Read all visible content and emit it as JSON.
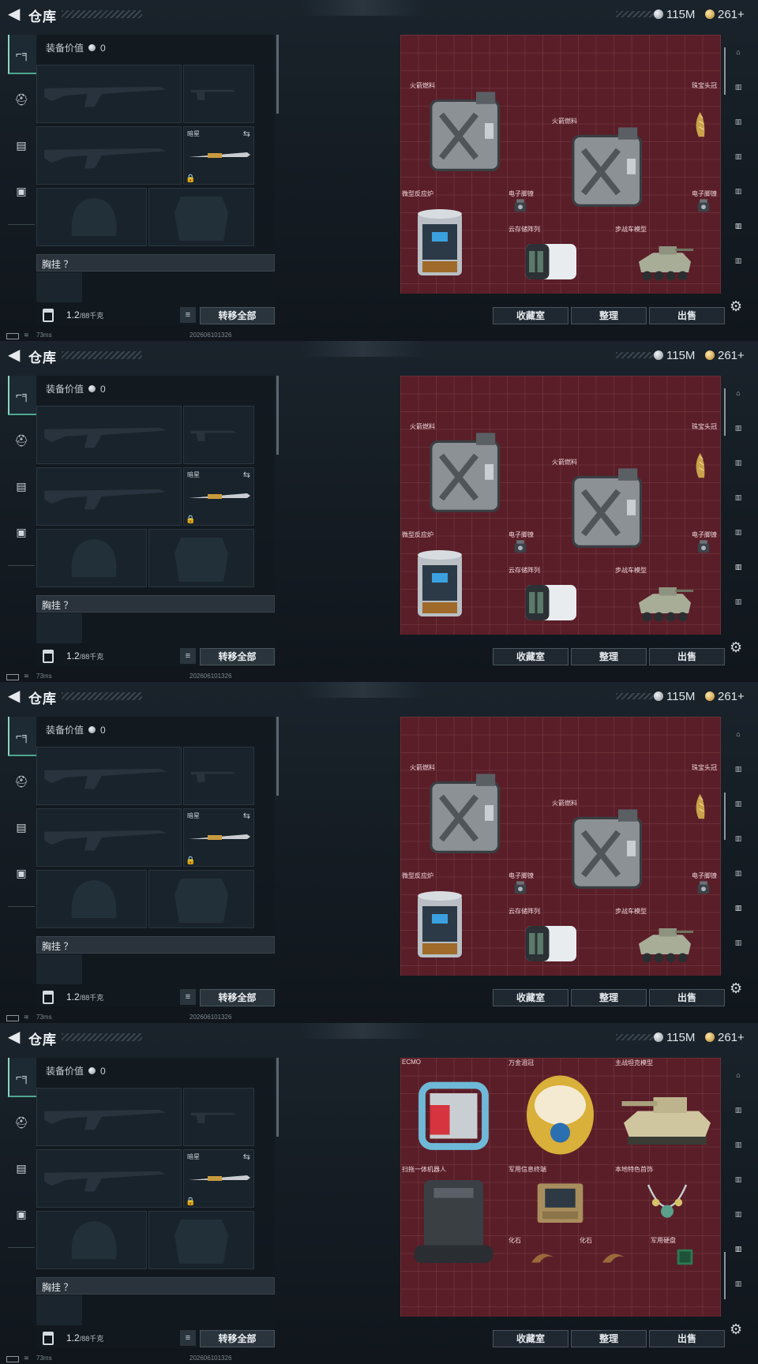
{
  "header": {
    "back": "<",
    "title": "仓库",
    "silver": "115M",
    "gold": "261+"
  },
  "loadout": {
    "value_label": "装备价值",
    "value": "0",
    "melee_name": "暗星",
    "rig_label": "胸挂 ？",
    "weight": "1.2",
    "weight_unit": "/88千克",
    "transfer_label": "转移全部",
    "list_icon": "≡"
  },
  "storage_buttons": {
    "collection": "收藏室",
    "organize": "整理",
    "sell": "出售"
  },
  "status": {
    "ping": "73ms",
    "stamp": "202606101326"
  },
  "panels": [
    {
      "items": [
        {
          "name": "火箭燃料"
        },
        {
          "name": "珠宝头冠"
        },
        {
          "name": "火箭燃料"
        },
        {
          "name": "微型反应炉"
        },
        {
          "name": "电子脚镣"
        },
        {
          "name": "电子脚镣"
        },
        {
          "name": "云存储阵列"
        },
        {
          "name": "步战车模型"
        }
      ]
    },
    {
      "items": [
        {
          "name": "火箭燃料"
        },
        {
          "name": "珠宝头冠"
        },
        {
          "name": "火箭燃料"
        },
        {
          "name": "微型反应炉"
        },
        {
          "name": "电子脚镣"
        },
        {
          "name": "电子脚镣"
        },
        {
          "name": "云存储阵列"
        },
        {
          "name": "步战车模型"
        }
      ]
    },
    {
      "items": [
        {
          "name": "火箭燃料"
        },
        {
          "name": "珠宝头冠"
        },
        {
          "name": "火箭燃料"
        },
        {
          "name": "微型反应炉"
        },
        {
          "name": "电子脚镣"
        },
        {
          "name": "电子脚镣"
        },
        {
          "name": "云存储阵列"
        },
        {
          "name": "步战车模型"
        }
      ]
    },
    {
      "items": [
        {
          "name": "ECMO"
        },
        {
          "name": "万金泪冠"
        },
        {
          "name": "主战坦克模型"
        },
        {
          "name": "扫拖一体机器人"
        },
        {
          "name": "军用信息终端"
        },
        {
          "name": "本地特色首饰"
        },
        {
          "name": "化石"
        },
        {
          "name": "化石"
        },
        {
          "name": "军用硬盘"
        }
      ]
    }
  ]
}
